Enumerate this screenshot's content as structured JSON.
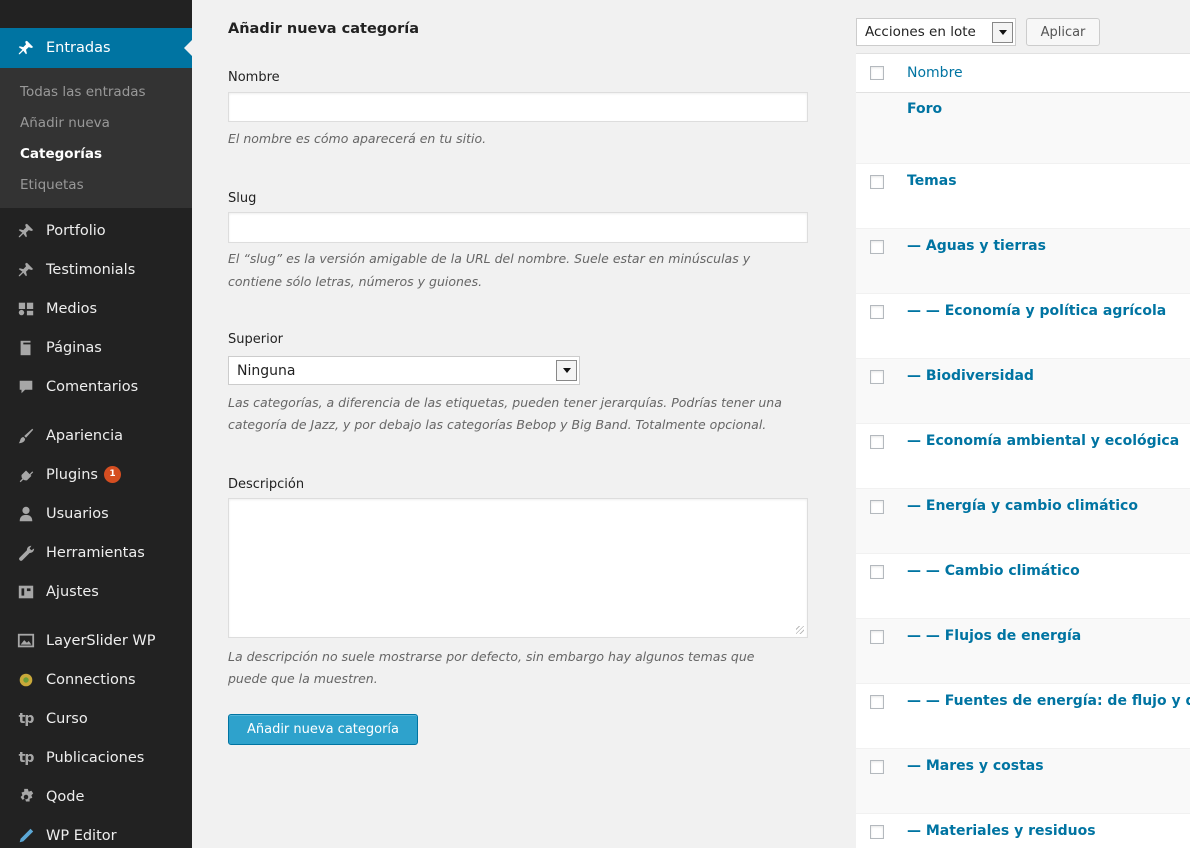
{
  "sidebar": {
    "active": {
      "label": "Entradas",
      "icon": "pin-icon"
    },
    "submenu": [
      "Todas las entradas",
      "Añadir nueva",
      "Categorías",
      "Etiquetas"
    ],
    "items": [
      {
        "label": "Portfolio",
        "icon": "pin-icon"
      },
      {
        "label": "Testimonials",
        "icon": "pin-icon"
      },
      {
        "label": "Medios",
        "icon": "media-icon"
      },
      {
        "label": "Páginas",
        "icon": "pages-icon"
      },
      {
        "label": "Comentarios",
        "icon": "comment-icon"
      },
      {
        "label": "Apariencia",
        "icon": "brush-icon"
      },
      {
        "label": "Plugins",
        "icon": "plugin-icon",
        "badge": "1"
      },
      {
        "label": "Usuarios",
        "icon": "users-icon"
      },
      {
        "label": "Herramientas",
        "icon": "wrench-icon"
      },
      {
        "label": "Ajustes",
        "icon": "settings-icon"
      },
      {
        "label": "LayerSlider WP",
        "icon": "layerslider-icon"
      },
      {
        "label": "Connections",
        "icon": "connections-icon"
      },
      {
        "label": "Curso",
        "icon": "tp-icon",
        "icon_text": "tp"
      },
      {
        "label": "Publicaciones",
        "icon": "tp-icon",
        "icon_text": "tp"
      },
      {
        "label": "Qode",
        "icon": "gear-icon"
      },
      {
        "label": "WP Editor",
        "icon": "pencil-icon"
      }
    ]
  },
  "form": {
    "title": "Añadir nueva categoría",
    "name_label": "Nombre",
    "name_value": "",
    "name_hint": "El nombre es cómo aparecerá en tu sitio.",
    "slug_label": "Slug",
    "slug_value": "",
    "slug_hint_1": "El “slug” es la versión amigable de la URL del nombre. Suele estar en minúsculas y",
    "slug_hint_2": "contiene sólo letras, números y guiones.",
    "parent_label": "Superior",
    "parent_value": "Ninguna",
    "parent_hint_1": "Las categorías, a diferencia de las etiquetas, pueden tener jerarquías. Podrías tener una",
    "parent_hint_2": "categoría de Jazz, y por debajo las categorías Bebop y Big Band. Totalmente opcional.",
    "desc_label": "Descripción",
    "desc_value": "",
    "desc_hint_1": "La descripción no suele mostrarse por defecto, sin embargo hay algunos temas que",
    "desc_hint_2": "puede que la muestren.",
    "submit_label": "Añadir nueva categoría"
  },
  "list": {
    "bulk_actions": "Acciones en lote",
    "apply_label": "Aplicar",
    "column_name": "Nombre",
    "rows": [
      {
        "name": "Foro",
        "checkbox": false
      },
      {
        "name": "Temas",
        "checkbox": true
      },
      {
        "name": "— Aguas y tierras",
        "checkbox": true
      },
      {
        "name": "— — Economía y política agrícola",
        "checkbox": true
      },
      {
        "name": "— Biodiversidad",
        "checkbox": true
      },
      {
        "name": "— Economía ambiental y ecológica",
        "checkbox": true
      },
      {
        "name": "— Energía y cambio climático",
        "checkbox": true
      },
      {
        "name": "— — Cambio climático",
        "checkbox": true
      },
      {
        "name": "— — Flujos de energía",
        "checkbox": true
      },
      {
        "name": "— — Fuentes de energía: de flujo y d",
        "checkbox": true
      },
      {
        "name": "— Mares y costas",
        "checkbox": true
      },
      {
        "name": "— Materiales y residuos",
        "checkbox": true
      }
    ]
  }
}
